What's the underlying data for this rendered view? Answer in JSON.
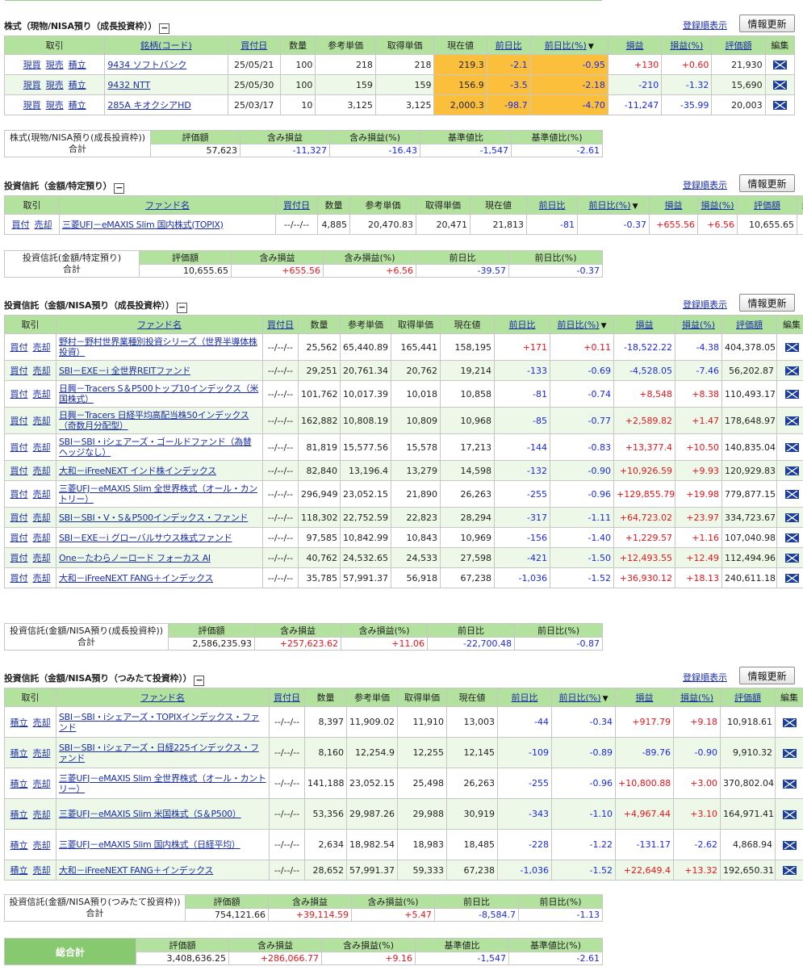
{
  "stocks": {
    "title": "株式（現物/NISA預り（成長投資枠））",
    "sort_label": "登録順表示",
    "update_label": "情報更新",
    "headers": [
      "取引",
      "銘柄(コード)",
      "買付日",
      "数量",
      "参考単価",
      "取得単価",
      "現在値",
      "前日比",
      "前日比(%)",
      "損益",
      "損益(%)",
      "評価額",
      "編集"
    ],
    "rows": [
      {
        "a1": "現買",
        "a2": "現売",
        "a3": "積立",
        "name": "9434 ソフトバンク",
        "date": "25/05/21",
        "qty": "100",
        "ref": "218",
        "acq": "218",
        "price": "219.3",
        "chg": "-2.1",
        "chgp": "-0.95",
        "pl": "+130",
        "plp": "+0.60",
        "val": "21,930"
      },
      {
        "a1": "現買",
        "a2": "現売",
        "a3": "積立",
        "name": "9432 NTT",
        "date": "25/05/30",
        "qty": "100",
        "ref": "159",
        "acq": "159",
        "price": "156.9",
        "chg": "-3.5",
        "chgp": "-2.18",
        "pl": "-210",
        "plp": "-1.32",
        "val": "15,690"
      },
      {
        "a1": "現買",
        "a2": "現売",
        "a3": "積立",
        "name": "285A キオクシアHD",
        "date": "25/03/17",
        "qty": "10",
        "ref": "3,125",
        "acq": "3,125",
        "price": "2,000.3",
        "chg": "-98.7",
        "chgp": "-4.70",
        "pl": "-11,247",
        "plp": "-35.99",
        "val": "20,003"
      }
    ],
    "summary": {
      "label": "株式(現物/NISA預り(成長投資枠))",
      "total_label": "合計",
      "headers": [
        "評価額",
        "含み損益",
        "含み損益(%)",
        "基準値比",
        "基準値比(%)"
      ],
      "values": [
        "57,623",
        "-11,327",
        "-16.43",
        "-1,547",
        "-2.61"
      ]
    }
  },
  "fund_tokutei": {
    "title": "投資信託（金額/特定預り）",
    "sort_label": "登録順表示",
    "update_label": "情報更新",
    "headers": [
      "取引",
      "ファンド名",
      "買付日",
      "数量",
      "参考単価",
      "取得単価",
      "現在値",
      "前日比",
      "前日比(%)",
      "損益",
      "損益(%)",
      "評価額",
      "編集"
    ],
    "rows": [
      {
        "a1": "買付",
        "a2": "売却",
        "name": "三菱UFJ－eMAXIS Slim 国内株式(TOPIX)",
        "date": "--/--/--",
        "qty": "4,885",
        "ref": "20,470.83",
        "acq": "20,471",
        "price": "21,813",
        "chg": "-81",
        "chgp": "-0.37",
        "pl": "+655.56",
        "plp": "+6.56",
        "val": "10,655.65"
      }
    ],
    "summary": {
      "label": "投資信託(金額/特定預り)",
      "total_label": "合計",
      "headers": [
        "評価額",
        "含み損益",
        "含み損益(%)",
        "前日比",
        "前日比(%)"
      ],
      "values": [
        "10,655.65",
        "+655.56",
        "+6.56",
        "-39.57",
        "-0.37"
      ]
    }
  },
  "fund_nisa_growth": {
    "title": "投資信託（金額/NISA預り（成長投資枠））",
    "sort_label": "登録順表示",
    "update_label": "情報更新",
    "headers": [
      "取引",
      "ファンド名",
      "買付日",
      "数量",
      "参考単価",
      "取得単価",
      "現在値",
      "前日比",
      "前日比(%)",
      "損益",
      "損益(%)",
      "評価額",
      "編集"
    ],
    "rows": [
      {
        "a1": "買付",
        "a2": "売却",
        "name": "野村－野村世界業種別投資シリーズ（世界半導体株投資）",
        "date": "--/--/--",
        "qty": "25,562",
        "ref": "65,440.89",
        "acq": "165,441",
        "price": "158,195",
        "chg": "+171",
        "chgp": "+0.11",
        "pl": "-18,522.22",
        "plp": "-4.38",
        "val": "404,378.05"
      },
      {
        "a1": "買付",
        "a2": "売却",
        "name": "SBI－EXE－i 全世界REITファンド",
        "date": "--/--/--",
        "qty": "29,251",
        "ref": "20,761.34",
        "acq": "20,762",
        "price": "19,214",
        "chg": "-133",
        "chgp": "-0.69",
        "pl": "-4,528.05",
        "plp": "-7.46",
        "val": "56,202.87"
      },
      {
        "a1": "買付",
        "a2": "売却",
        "name": "日興－Tracers S＆P500トップ10インデックス（米国株式）",
        "date": "--/--/--",
        "qty": "101,762",
        "ref": "10,017.39",
        "acq": "10,018",
        "price": "10,858",
        "chg": "-81",
        "chgp": "-0.74",
        "pl": "+8,548",
        "plp": "+8.38",
        "val": "110,493.17"
      },
      {
        "a1": "買付",
        "a2": "売却",
        "name": "日興－Tracers 日経平均高配当株50インデックス（奇数月分配型）",
        "date": "--/--/--",
        "qty": "162,882",
        "ref": "10,808.19",
        "acq": "10,809",
        "price": "10,968",
        "chg": "-85",
        "chgp": "-0.77",
        "pl": "+2,589.82",
        "plp": "+1.47",
        "val": "178,648.97"
      },
      {
        "a1": "買付",
        "a2": "売却",
        "name": "SBI－SBI・iシェアーズ・ゴールドファンド（為替ヘッジなし）",
        "date": "--/--/--",
        "qty": "81,819",
        "ref": "15,577.56",
        "acq": "15,578",
        "price": "17,213",
        "chg": "-144",
        "chgp": "-0.83",
        "pl": "+13,377.4",
        "plp": "+10.50",
        "val": "140,835.04"
      },
      {
        "a1": "買付",
        "a2": "売却",
        "name": "大和－iFreeNEXT インド株インデックス",
        "date": "--/--/--",
        "qty": "82,840",
        "ref": "13,196.4",
        "acq": "13,279",
        "price": "14,598",
        "chg": "-132",
        "chgp": "-0.90",
        "pl": "+10,926.59",
        "plp": "+9.93",
        "val": "120,929.83"
      },
      {
        "a1": "買付",
        "a2": "売却",
        "name": "三菱UFJ－eMAXIS Slim 全世界株式（オール・カントリー）",
        "date": "--/--/--",
        "qty": "296,949",
        "ref": "23,052.15",
        "acq": "21,890",
        "price": "26,263",
        "chg": "-255",
        "chgp": "-0.96",
        "pl": "+129,855.79",
        "plp": "+19.98",
        "val": "779,877.15"
      },
      {
        "a1": "買付",
        "a2": "売却",
        "name": "SBI－SBI・V・S＆P500インデックス・ファンド",
        "date": "--/--/--",
        "qty": "118,302",
        "ref": "22,752.59",
        "acq": "22,823",
        "price": "28,294",
        "chg": "-317",
        "chgp": "-1.11",
        "pl": "+64,723.02",
        "plp": "+23.97",
        "val": "334,723.67"
      },
      {
        "a1": "買付",
        "a2": "売却",
        "name": "SBI－EXE－i グローバルサウス株式ファンド",
        "date": "--/--/--",
        "qty": "97,585",
        "ref": "10,842.99",
        "acq": "10,843",
        "price": "10,969",
        "chg": "-156",
        "chgp": "-1.40",
        "pl": "+1,229.57",
        "plp": "+1.16",
        "val": "107,040.98"
      },
      {
        "a1": "買付",
        "a2": "売却",
        "name": "One－たわらノーロード フォーカス AI",
        "date": "--/--/--",
        "qty": "40,762",
        "ref": "24,532.65",
        "acq": "24,533",
        "price": "27,598",
        "chg": "-421",
        "chgp": "-1.50",
        "pl": "+12,493.55",
        "plp": "+12.49",
        "val": "112,494.96"
      },
      {
        "a1": "買付",
        "a2": "売却",
        "name": "大和－iFreeNEXT FANG＋インデックス",
        "date": "--/--/--",
        "qty": "35,785",
        "ref": "57,991.37",
        "acq": "56,918",
        "price": "67,238",
        "chg": "-1,036",
        "chgp": "-1.52",
        "pl": "+36,930.12",
        "plp": "+18.13",
        "val": "240,611.18"
      }
    ],
    "summary": {
      "label": "投資信託(金額/NISA預り(成長投資枠))",
      "total_label": "合計",
      "headers": [
        "評価額",
        "含み損益",
        "含み損益(%)",
        "前日比",
        "前日比(%)"
      ],
      "values": [
        "2,586,235.93",
        "+257,623.62",
        "+11.06",
        "-22,700.48",
        "-0.87"
      ]
    }
  },
  "fund_nisa_tsumitate": {
    "title": "投資信託（金額/NISA預り（つみたて投資枠））",
    "sort_label": "登録順表示",
    "update_label": "情報更新",
    "headers": [
      "取引",
      "ファンド名",
      "買付日",
      "数量",
      "参考単価",
      "取得単価",
      "現在値",
      "前日比",
      "前日比(%)",
      "損益",
      "損益(%)",
      "評価額",
      "編集"
    ],
    "rows": [
      {
        "a1": "積立",
        "a2": "売却",
        "name": "SBI－SBI・iシェアーズ・TOPIXインデックス・ファンド",
        "date": "--/--/--",
        "qty": "8,397",
        "ref": "11,909.02",
        "acq": "11,910",
        "price": "13,003",
        "chg": "-44",
        "chgp": "-0.34",
        "pl": "+917.79",
        "plp": "+9.18",
        "val": "10,918.61"
      },
      {
        "a1": "積立",
        "a2": "売却",
        "name": "SBI－SBI・iシェアーズ・日経225インデックス・ファンド",
        "date": "--/--/--",
        "qty": "8,160",
        "ref": "12,254.9",
        "acq": "12,255",
        "price": "12,145",
        "chg": "-109",
        "chgp": "-0.89",
        "pl": "-89.76",
        "plp": "-0.90",
        "val": "9,910.32"
      },
      {
        "a1": "積立",
        "a2": "売却",
        "name": "三菱UFJ－eMAXIS Slim 全世界株式（オール・カントリー）",
        "date": "--/--/--",
        "qty": "141,188",
        "ref": "23,052.15",
        "acq": "25,498",
        "price": "26,263",
        "chg": "-255",
        "chgp": "-0.96",
        "pl": "+10,800.88",
        "plp": "+3.00",
        "val": "370,802.04"
      },
      {
        "a1": "積立",
        "a2": "売却",
        "name": "三菱UFJ－eMAXIS Slim 米国株式（S＆P500）",
        "date": "--/--/--",
        "qty": "53,356",
        "ref": "29,987.26",
        "acq": "29,988",
        "price": "30,919",
        "chg": "-343",
        "chgp": "-1.10",
        "pl": "+4,967.44",
        "plp": "+3.10",
        "val": "164,971.41"
      },
      {
        "a1": "積立",
        "a2": "売却",
        "name": "三菱UFJ－eMAXIS Slim 国内株式（日経平均）",
        "date": "--/--/--",
        "qty": "2,634",
        "ref": "18,982.54",
        "acq": "18,983",
        "price": "18,485",
        "chg": "-228",
        "chgp": "-1.22",
        "pl": "-131.17",
        "plp": "-2.62",
        "val": "4,868.94"
      },
      {
        "a1": "積立",
        "a2": "売却",
        "name": "大和－iFreeNEXT FANG＋インデックス",
        "date": "--/--/--",
        "qty": "28,652",
        "ref": "57,991.37",
        "acq": "59,333",
        "price": "67,238",
        "chg": "-1,036",
        "chgp": "-1.52",
        "pl": "+22,649.4",
        "plp": "+13.32",
        "val": "192,650.31"
      }
    ],
    "summary": {
      "label": "投資信託(金額/NISA預り(つみたて投資枠))",
      "total_label": "合計",
      "headers": [
        "評価額",
        "含み損益",
        "含み損益(%)",
        "前日比",
        "前日比(%)"
      ],
      "values": [
        "754,121.66",
        "+39,114.59",
        "+5.47",
        "-8,584.7",
        "-1.13"
      ]
    }
  },
  "grand_total": {
    "label": "総合計",
    "headers": [
      "評価額",
      "含み損益",
      "含み損益(%)",
      "基準値比",
      "基準値比(%)"
    ],
    "values": [
      "3,408,636.25",
      "+286,066.77",
      "+9.16",
      "-1,547",
      "-2.61"
    ]
  },
  "icons": {
    "edit": "mail-envelope-icon",
    "sort": "sort-desc-arrow"
  },
  "colors": {
    "header_bg": "#b3e29e",
    "even_row": "#eef8e8",
    "positive": "#e8141c",
    "negative": "#1a2ae6",
    "highlight": "#fbbf3b",
    "link": "#1a2ea8"
  }
}
